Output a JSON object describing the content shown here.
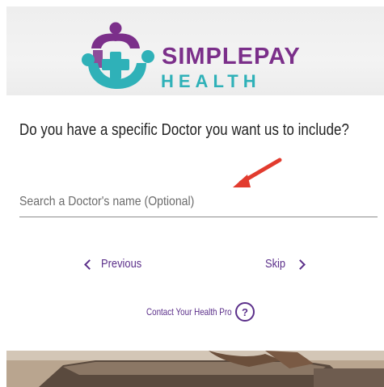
{
  "brand": {
    "name_top": "SIMPLEPAY",
    "name_bottom": "HEALTH",
    "colors": {
      "purple": "#7b2f8a",
      "teal": "#2fb1b8"
    }
  },
  "question": "Do you have a specific Doctor you want us to include?",
  "search": {
    "placeholder": "Search a Doctor's name (Optional)",
    "value": ""
  },
  "nav": {
    "previous_label": "Previous",
    "skip_label": "Skip"
  },
  "contact": {
    "label": "Contact Your Health Pro",
    "icon": "question-circle-icon"
  },
  "annotation": {
    "icon": "red-arrow-icon",
    "color": "#e23b2e"
  },
  "accent_color": "#5b2f8a"
}
